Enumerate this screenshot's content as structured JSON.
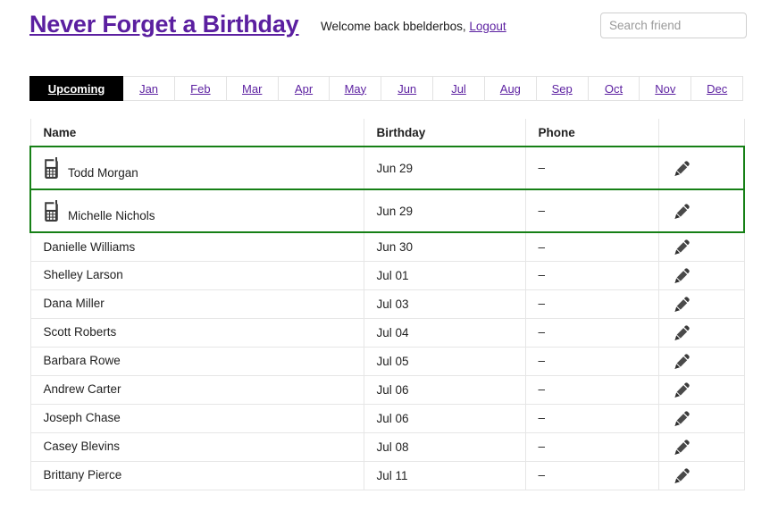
{
  "header": {
    "app_title": "Never Forget a Birthday",
    "welcome_text": "Welcome back bbelderbos,",
    "logout_label": "Logout",
    "search_placeholder": "Search friend",
    "search_value": "",
    "title_color": "#5b1fa0",
    "link_color": "#5b1fa0"
  },
  "tabs": {
    "active": "Upcoming",
    "items": [
      {
        "label": "Upcoming",
        "active": true
      },
      {
        "label": "Jan",
        "active": false
      },
      {
        "label": "Feb",
        "active": false
      },
      {
        "label": "Mar",
        "active": false
      },
      {
        "label": "Apr",
        "active": false
      },
      {
        "label": "May",
        "active": false
      },
      {
        "label": "Jun",
        "active": false
      },
      {
        "label": "Jul",
        "active": false
      },
      {
        "label": "Aug",
        "active": false
      },
      {
        "label": "Sep",
        "active": false
      },
      {
        "label": "Oct",
        "active": false
      },
      {
        "label": "Nov",
        "active": false
      },
      {
        "label": "Dec",
        "active": false
      }
    ]
  },
  "table": {
    "columns": [
      "Name",
      "Birthday",
      "Phone",
      ""
    ],
    "highlight_color": "#168016",
    "edit_icon": "pencil-icon",
    "mobile_icon": "mobile-phone-icon",
    "rows": [
      {
        "name": "Todd Morgan",
        "birthday": "Jun 29",
        "phone": "–",
        "highlight": true,
        "has_mobile_icon": true
      },
      {
        "name": "Michelle Nichols",
        "birthday": "Jun 29",
        "phone": "–",
        "highlight": true,
        "has_mobile_icon": true
      },
      {
        "name": "Danielle Williams",
        "birthday": "Jun 30",
        "phone": "–",
        "highlight": false,
        "has_mobile_icon": false
      },
      {
        "name": "Shelley Larson",
        "birthday": "Jul 01",
        "phone": "–",
        "highlight": false,
        "has_mobile_icon": false
      },
      {
        "name": "Dana Miller",
        "birthday": "Jul 03",
        "phone": "–",
        "highlight": false,
        "has_mobile_icon": false
      },
      {
        "name": "Scott Roberts",
        "birthday": "Jul 04",
        "phone": "–",
        "highlight": false,
        "has_mobile_icon": false
      },
      {
        "name": "Barbara Rowe",
        "birthday": "Jul 05",
        "phone": "–",
        "highlight": false,
        "has_mobile_icon": false
      },
      {
        "name": "Andrew Carter",
        "birthday": "Jul 06",
        "phone": "–",
        "highlight": false,
        "has_mobile_icon": false
      },
      {
        "name": "Joseph Chase",
        "birthday": "Jul 06",
        "phone": "–",
        "highlight": false,
        "has_mobile_icon": false
      },
      {
        "name": "Casey Blevins",
        "birthday": "Jul 08",
        "phone": "–",
        "highlight": false,
        "has_mobile_icon": false
      },
      {
        "name": "Brittany Pierce",
        "birthday": "Jul 11",
        "phone": "–",
        "highlight": false,
        "has_mobile_icon": false
      }
    ]
  }
}
